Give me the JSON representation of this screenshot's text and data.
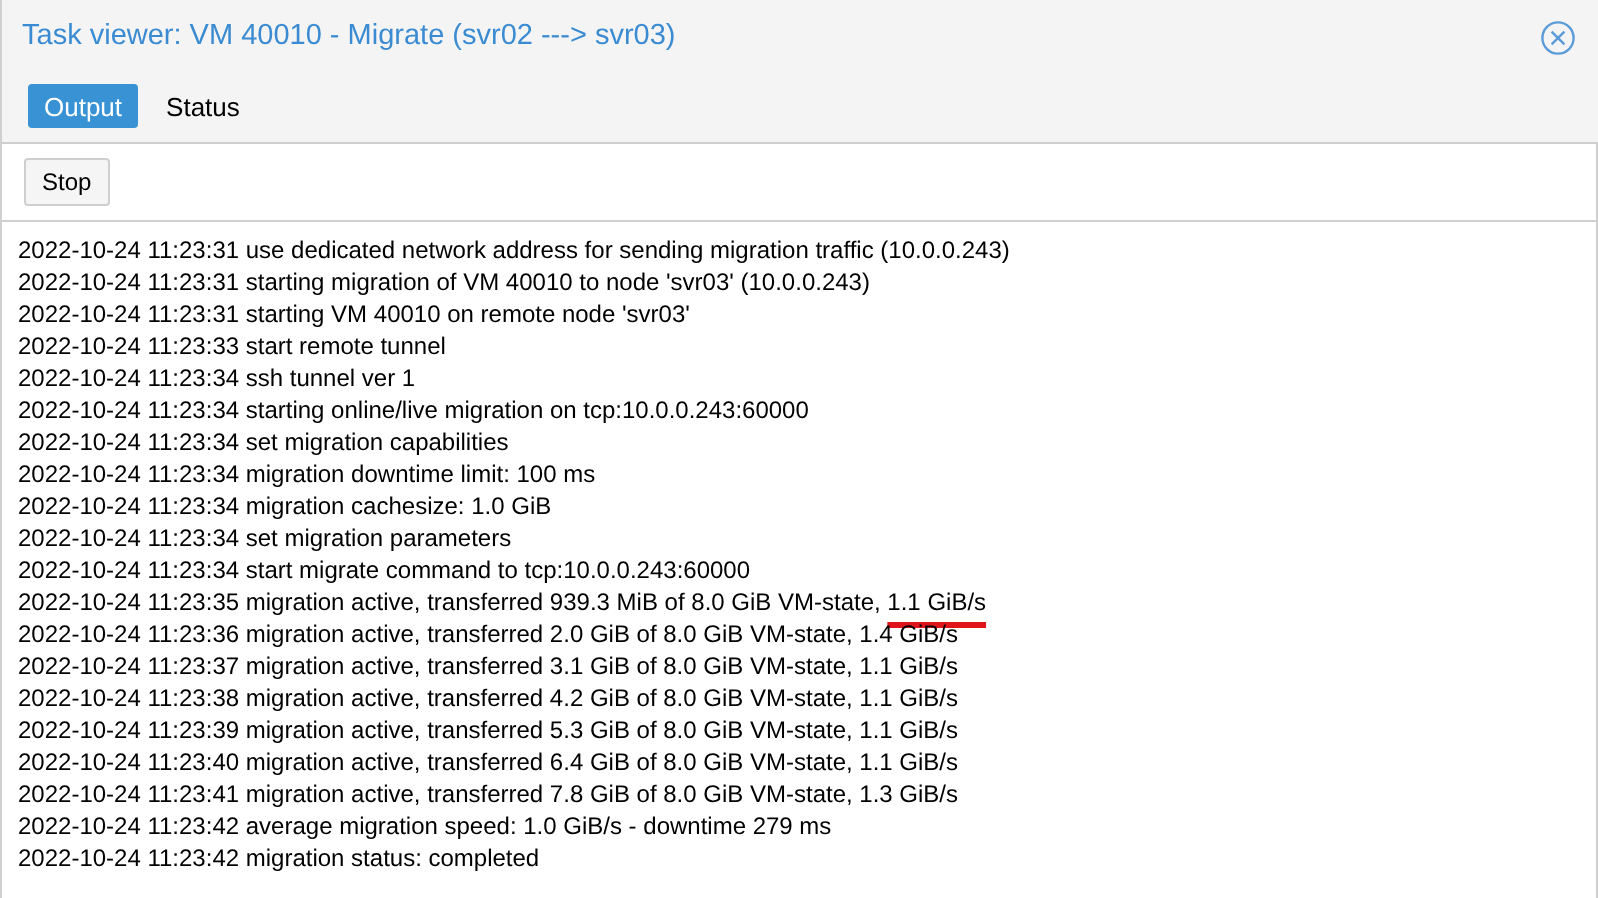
{
  "window": {
    "title": "Task viewer: VM 40010 - Migrate (svr02 ---> svr03)"
  },
  "tabs": [
    {
      "label": "Output",
      "selected": true
    },
    {
      "label": "Status",
      "selected": false
    }
  ],
  "toolbar": {
    "buttons": [
      "Stop"
    ]
  },
  "log": [
    {
      "text": "2022-10-24 11:23:31 use dedicated network address for sending migration traffic (10.0.0.243)"
    },
    {
      "text": "2022-10-24 11:23:31 starting migration of VM 40010 to node 'svr03' (10.0.0.243)"
    },
    {
      "text": "2022-10-24 11:23:31 starting VM 40010 on remote node 'svr03'"
    },
    {
      "text": "2022-10-24 11:23:33 start remote tunnel"
    },
    {
      "text": "2022-10-24 11:23:34 ssh tunnel ver 1"
    },
    {
      "text": "2022-10-24 11:23:34 starting online/live migration on tcp:10.0.0.243:60000"
    },
    {
      "text": "2022-10-24 11:23:34 set migration capabilities"
    },
    {
      "text": "2022-10-24 11:23:34 migration downtime limit: 100 ms"
    },
    {
      "text": "2022-10-24 11:23:34 migration cachesize: 1.0 GiB"
    },
    {
      "text": "2022-10-24 11:23:34 set migration parameters"
    },
    {
      "text": "2022-10-24 11:23:34 start migrate command to tcp:10.0.0.243:60000"
    },
    {
      "text": "2022-10-24 11:23:35 migration active, transferred 939.3 MiB of 8.0 GiB VM-state, ",
      "marked": "1.1 GiB/s"
    },
    {
      "text": "2022-10-24 11:23:36 migration active, transferred 2.0 GiB of 8.0 GiB VM-state, 1.4 GiB/s"
    },
    {
      "text": "2022-10-24 11:23:37 migration active, transferred 3.1 GiB of 8.0 GiB VM-state, 1.1 GiB/s"
    },
    {
      "text": "2022-10-24 11:23:38 migration active, transferred 4.2 GiB of 8.0 GiB VM-state, 1.1 GiB/s"
    },
    {
      "text": "2022-10-24 11:23:39 migration active, transferred 5.3 GiB of 8.0 GiB VM-state, 1.1 GiB/s"
    },
    {
      "text": "2022-10-24 11:23:40 migration active, transferred 6.4 GiB of 8.0 GiB VM-state, 1.1 GiB/s"
    },
    {
      "text": "2022-10-24 11:23:41 migration active, transferred 7.8 GiB of 8.0 GiB VM-state, 1.3 GiB/s"
    },
    {
      "text": "2022-10-24 11:23:42 average migration speed: 1.0 GiB/s - downtime 279 ms"
    },
    {
      "text": "2022-10-24 11:23:42 migration status: completed"
    }
  ]
}
